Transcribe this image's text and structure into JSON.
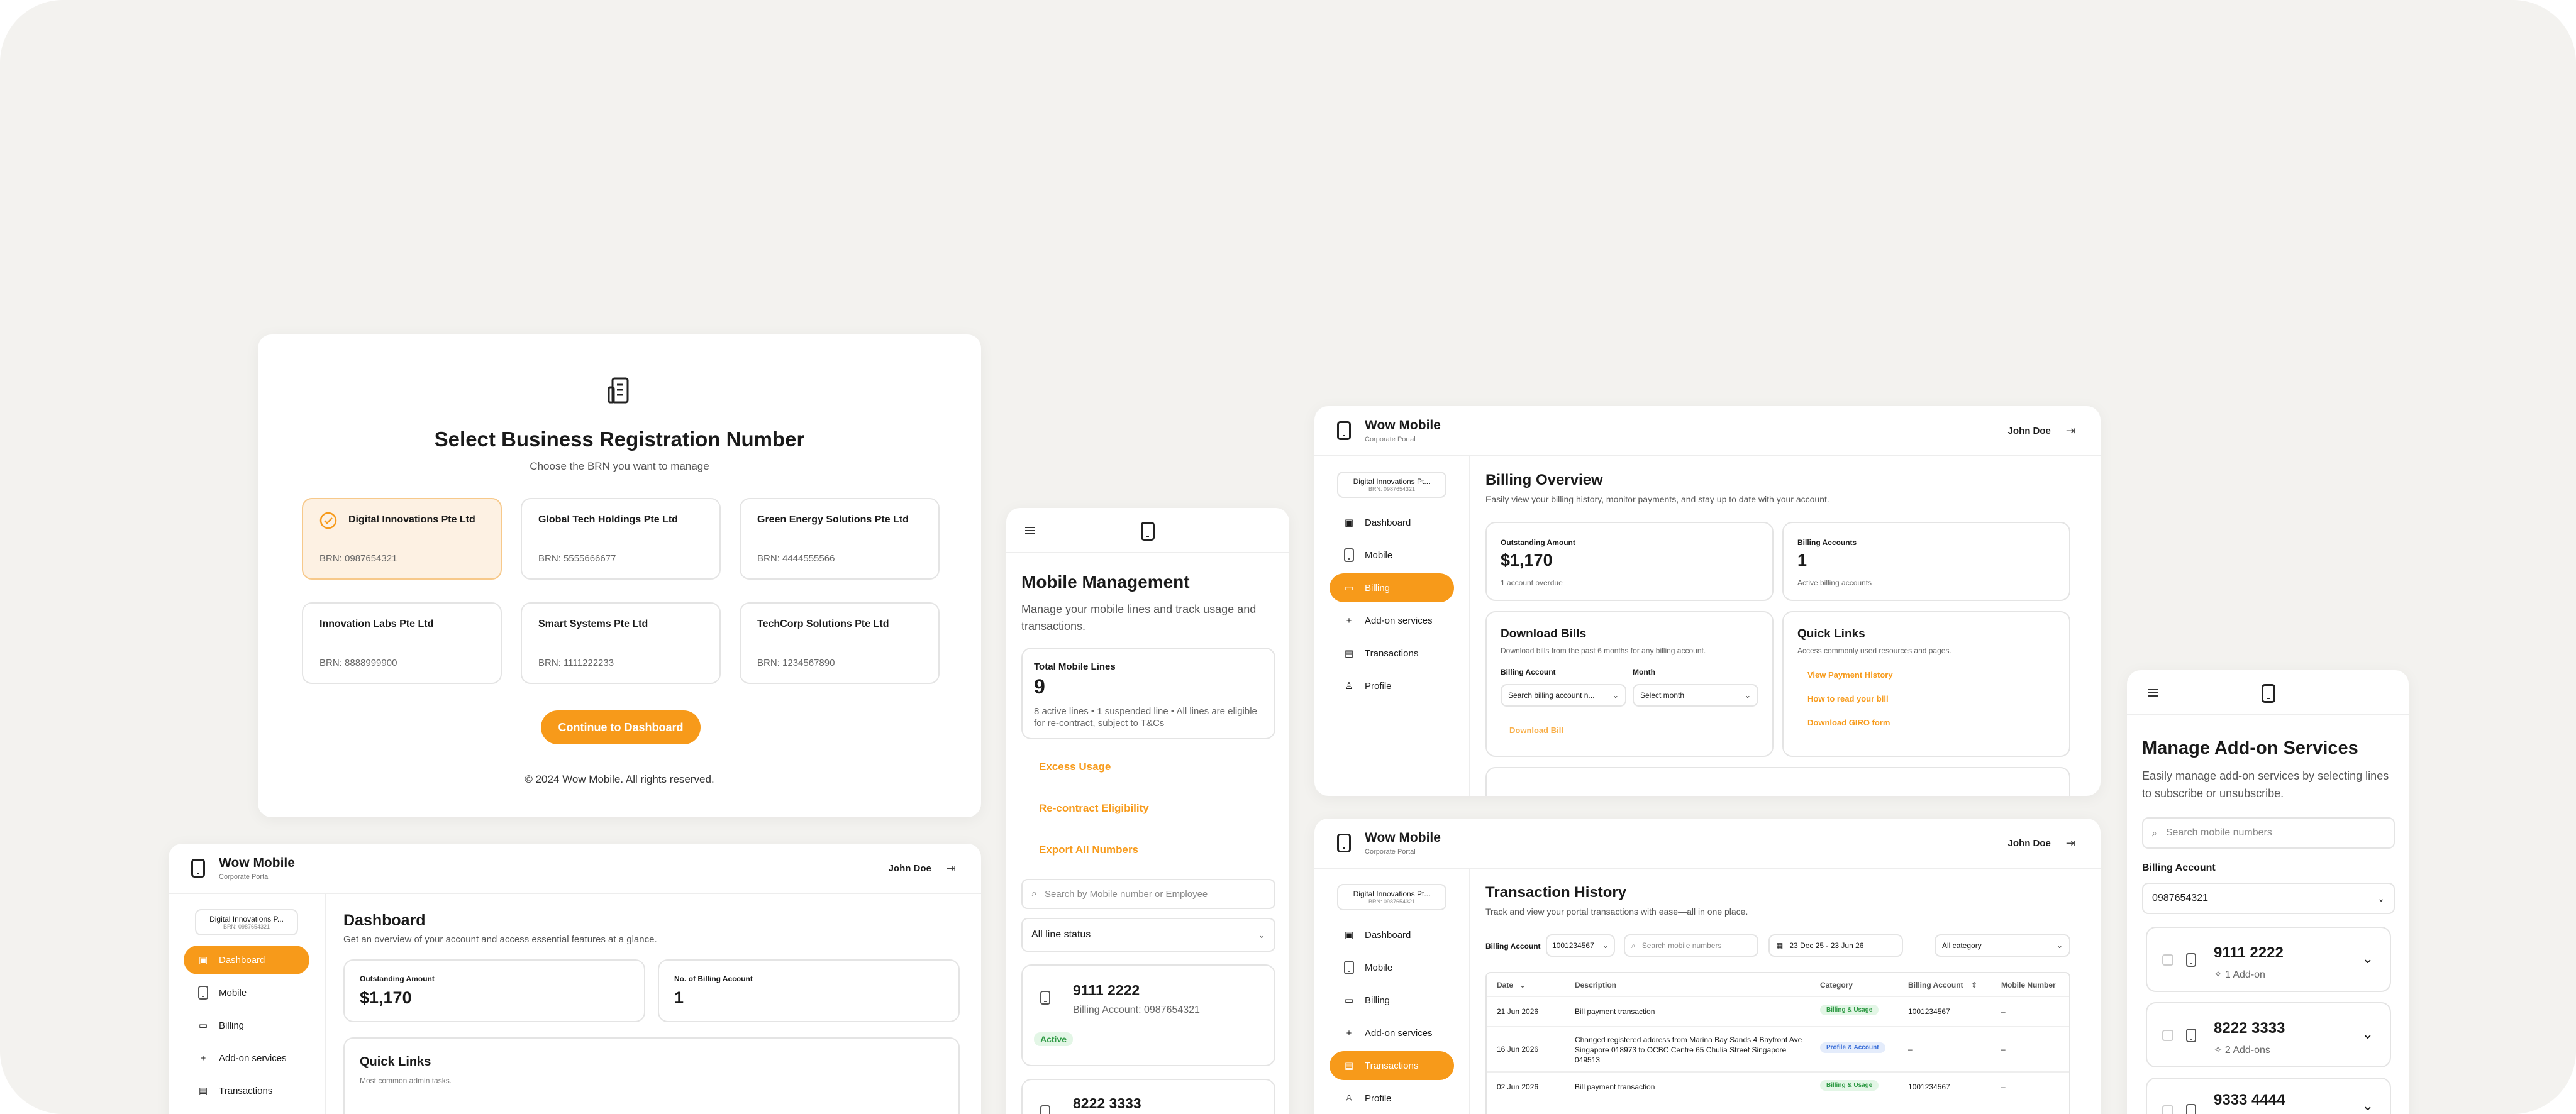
{
  "brn": {
    "title": "Select Business Registration Number",
    "subtitle": "Choose the BRN you want to manage",
    "companies": [
      {
        "name": "Digital Innovations Pte Ltd",
        "brn": "BRN: 0987654321"
      },
      {
        "name": "Global Tech Holdings Pte Ltd",
        "brn": "BRN: 5555666677"
      },
      {
        "name": "Green Energy Solutions Pte Ltd",
        "brn": "BRN: 4444555566"
      },
      {
        "name": "Innovation Labs Pte Ltd",
        "brn": "BRN: 8888999900"
      },
      {
        "name": "Smart Systems Pte Ltd",
        "brn": "BRN: 1111222233"
      },
      {
        "name": "TechCorp Solutions Pte Ltd",
        "brn": "BRN: 1234567890"
      }
    ],
    "continue": "Continue to Dashboard",
    "footer": "© 2024 Wow Mobile. All rights reserved."
  },
  "brand": {
    "name": "Wow Mobile",
    "sub": "Corporate Portal",
    "user": "John Doe",
    "acct": "Digital Innovations P...",
    "acct_brn": "BRN: 0987654321",
    "acct_short": "Digital Innovations Pt...",
    "acct_short2": "Digital Innovations Pt..."
  },
  "nav": [
    "Dashboard",
    "Mobile",
    "Billing",
    "Add-on services",
    "Transactions",
    "Profile"
  ],
  "dashboard": {
    "title": "Dashboard",
    "subtitle": "Get an overview of your account and access essential features at a glance.",
    "outstanding_label": "Outstanding Amount",
    "outstanding": "$1,170",
    "billing_label": "No. of Billing Account",
    "billing": "1",
    "ql_title": "Quick Links",
    "ql_sub": "Most common admin tasks."
  },
  "mobile": {
    "title": "Mobile Management",
    "subtitle": "Manage your mobile lines and track usage and transactions.",
    "total_label": "Total Mobile Lines",
    "total": "9",
    "total_desc": "8 active lines • 1 suspended line • All lines are eligible for re-contract, subject to T&Cs",
    "links": [
      "Excess Usage",
      "Re-contract Eligibility",
      "Export All Numbers"
    ],
    "search_ph": "Search by Mobile number or Employee",
    "status": "All line status",
    "lines": [
      {
        "number": "9111 2222",
        "account": "Billing Account: 0987654321",
        "status": "Active"
      },
      {
        "number": "8222 3333"
      }
    ]
  },
  "billing": {
    "title": "Billing Overview",
    "subtitle": "Easily view your billing history, monitor payments, and stay up to date with your account.",
    "outstanding_label": "Outstanding Amount",
    "outstanding": "$1,170",
    "outstanding_note": "1 account overdue",
    "accounts_label": "Billing Accounts",
    "accounts": "1",
    "accounts_note": "Active billing accounts",
    "dl_title": "Download Bills",
    "dl_sub": "Download bills from the past 6 months for any billing account.",
    "acct_label": "Billing Account",
    "acct_ph": "Search billing account n...",
    "month_label": "Month",
    "month_ph": "Select month",
    "dl_btn": "Download Bill",
    "ql_title": "Quick Links",
    "ql_sub": "Access commonly used resources and pages.",
    "ql": [
      "View Payment History",
      "How to read your bill",
      "Download GIRO form"
    ]
  },
  "tx": {
    "title": "Transaction History",
    "subtitle": "Track and view your portal transactions with ease—all in one place.",
    "acct_label": "Billing Account",
    "acct": "1001234567",
    "search_ph": "Search mobile numbers",
    "date": "23 Dec 25 - 23 Jun 26",
    "category": "All category",
    "cols": [
      "Date",
      "Description",
      "Category",
      "Billing Account",
      "Mobile Number"
    ],
    "rows": [
      {
        "date": "21 Jun 2026",
        "desc": "Bill payment transaction",
        "cat": "Billing & Usage",
        "acct": "1001234567",
        "mobile": "–"
      },
      {
        "date": "16 Jun 2026",
        "desc": "Changed registered address from Marina Bay Sands 4 Bayfront Ave Singapore 018973 to OCBC Centre 65 Chulia Street Singapore 049513",
        "cat": "Profile & Account",
        "acct": "–",
        "mobile": "–"
      },
      {
        "date": "02 Jun 2026",
        "desc": "Bill payment transaction",
        "cat": "Billing & Usage",
        "acct": "1001234567",
        "mobile": "–"
      }
    ]
  },
  "addon": {
    "title": "Manage Add-on Services",
    "subtitle": "Easily manage add-on services by selecting lines to subscribe or unsubscribe.",
    "search_ph": "Search mobile numbers",
    "acct_label": "Billing Account",
    "acct": "0987654321",
    "lines": [
      {
        "number": "9111 2222",
        "addons": "1 Add-on"
      },
      {
        "number": "8222 3333",
        "addons": "2 Add-ons"
      },
      {
        "number": "9333 4444"
      }
    ]
  },
  "colors": {
    "accent": "#f79a1a",
    "bg": "#f3f2ef",
    "green": "#2e9a44",
    "blue": "#3b6fd8"
  }
}
